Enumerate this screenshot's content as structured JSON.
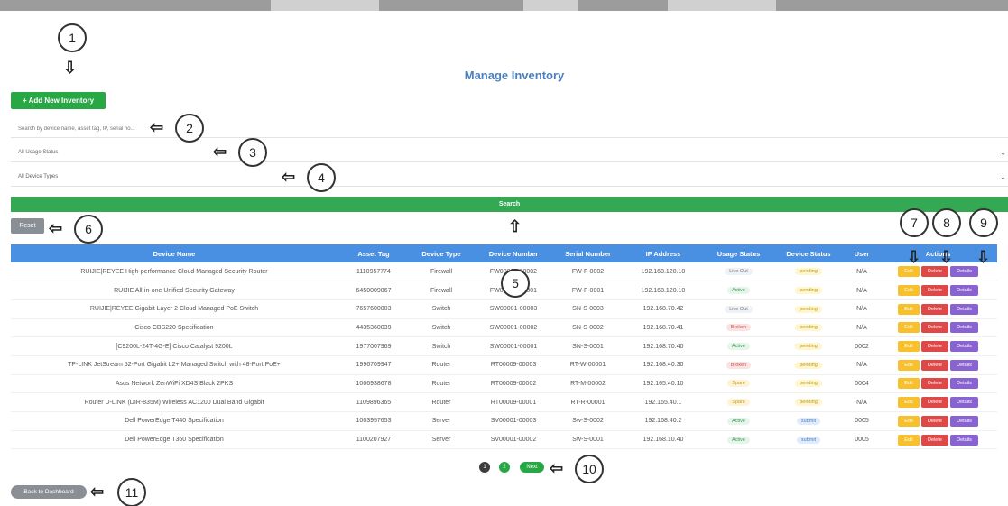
{
  "page": {
    "title": "Manage Inventory"
  },
  "toolbar": {
    "add_label": "+ Add New Inventory",
    "search_placeholder": "Search by device name, asset tag, IP, serial no...",
    "usage_status_value": "All Usage Status",
    "device_type_value": "All Device Types",
    "search_label": "Search",
    "reset_label": "Reset"
  },
  "table": {
    "headers": [
      "Device Name",
      "Asset Tag",
      "Device Type",
      "Device Number",
      "Serial Number",
      "IP Address",
      "Usage Status",
      "Device Status",
      "User",
      "Actions"
    ],
    "rows": [
      {
        "name": "RUIJIE|REYEE High-performance Cloud Managed Security Router",
        "asset_tag": "1110957774",
        "type": "Firewall",
        "number": "FW00003-00002",
        "serial": "FW-F-0002",
        "ip": "192.168.120.10",
        "usage": "Live Out",
        "status": "pending",
        "user": "N/A"
      },
      {
        "name": "RUIJIE All-in-one Unified Security Gateway",
        "asset_tag": "6450009867",
        "type": "Firewall",
        "number": "FW00003-00001",
        "serial": "FW-F-0001",
        "ip": "192.168.120.10",
        "usage": "Active",
        "status": "pending",
        "user": "N/A"
      },
      {
        "name": "RUIJIE|REYEE Gigabit Layer 2 Cloud Managed PoE Switch",
        "asset_tag": "7657600003",
        "type": "Switch",
        "number": "SW00001-00003",
        "serial": "SN-S-0003",
        "ip": "192.168.70.42",
        "usage": "Live Out",
        "status": "pending",
        "user": "N/A"
      },
      {
        "name": "Cisco CBS220 Specification",
        "asset_tag": "4435360039",
        "type": "Switch",
        "number": "SW00001-00002",
        "serial": "SN-S-0002",
        "ip": "192.168.70.41",
        "usage": "Broken",
        "status": "pending",
        "user": "N/A"
      },
      {
        "name": "[C9200L-24T-4G-E] Cisco Catalyst 9200L",
        "asset_tag": "1977007969",
        "type": "Switch",
        "number": "SW00001-00001",
        "serial": "SN-S-0001",
        "ip": "192.168.70.40",
        "usage": "Active",
        "status": "pending",
        "user": "0002"
      },
      {
        "name": "TP-LINK JetStream 52-Port Gigabit L2+ Managed Switch with 48-Port PoE+",
        "asset_tag": "1996709947",
        "type": "Router",
        "number": "RT00009-00003",
        "serial": "RT-W-00001",
        "ip": "192.168.40.30",
        "usage": "Broken",
        "status": "pending",
        "user": "N/A"
      },
      {
        "name": "Asus Network ZenWiFi XD4S Black 2PKS",
        "asset_tag": "1006938678",
        "type": "Router",
        "number": "RT00009-00002",
        "serial": "RT-M-00002",
        "ip": "192.165.40.10",
        "usage": "Spare",
        "status": "pending",
        "user": "0004"
      },
      {
        "name": "Router D-LINK (DIR-835M) Wireless AC1200 Dual Band Gigabit",
        "asset_tag": "1109896365",
        "type": "Router",
        "number": "RT00009-00001",
        "serial": "RT-R-00001",
        "ip": "192.165.40.1",
        "usage": "Spare",
        "status": "pending",
        "user": "N/A"
      },
      {
        "name": "Dell PowerEdge T440 Specification",
        "asset_tag": "1003957653",
        "type": "Server",
        "number": "SV00001-00003",
        "serial": "Sw-S-0002",
        "ip": "192.168.40.2",
        "usage": "Active",
        "status": "submit",
        "user": "0005"
      },
      {
        "name": "Dell PowerEdge T360 Specification",
        "asset_tag": "1100207927",
        "type": "Server",
        "number": "SV00001-00002",
        "serial": "Sw-S-0001",
        "ip": "192.168.10.40",
        "usage": "Active",
        "status": "submit",
        "user": "0005"
      }
    ],
    "actions": {
      "edit": "Edit",
      "delete": "Delete",
      "details": "Details"
    }
  },
  "pagination": {
    "page1": "1",
    "page2": "2",
    "next": "Next"
  },
  "footer": {
    "back_label": "Back to Dashboard"
  },
  "callouts": [
    "1",
    "2",
    "3",
    "4",
    "5",
    "6",
    "7",
    "8",
    "9",
    "10",
    "11"
  ]
}
